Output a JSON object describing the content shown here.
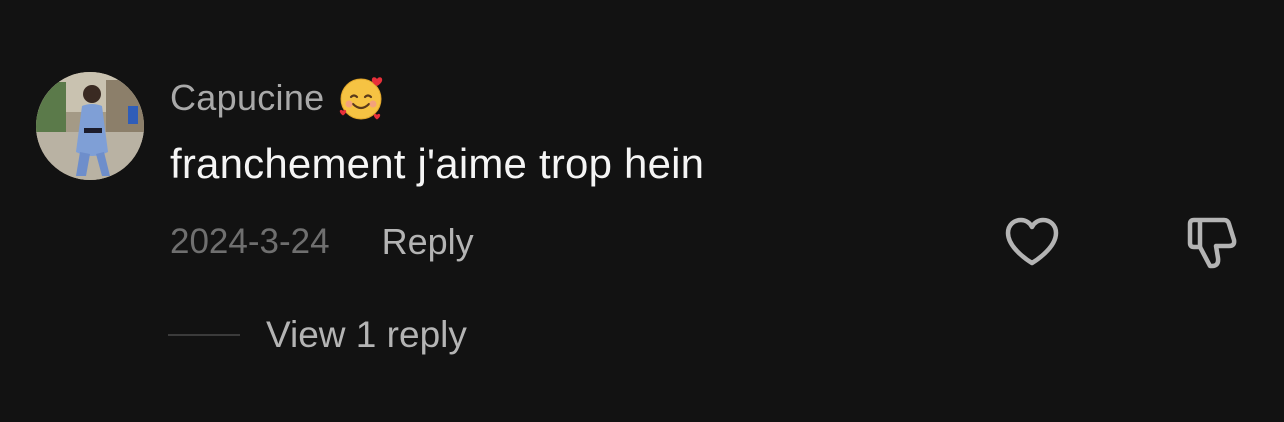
{
  "comment": {
    "username": "Capucine",
    "username_emoji": "smiling-face-with-hearts-emoji",
    "text": "franchement j'aime trop hein",
    "timestamp": "2024-3-24",
    "reply_label": "Reply",
    "view_replies_label": "View 1 reply",
    "like_icon": "heart-outline-icon",
    "dislike_icon": "thumbs-down-outline-icon"
  },
  "colors": {
    "background": "#121212",
    "username": "#a9a9a9",
    "text": "#f5f5f5",
    "secondary": "#b4b4b4",
    "timestamp": "#6f6f6f"
  }
}
